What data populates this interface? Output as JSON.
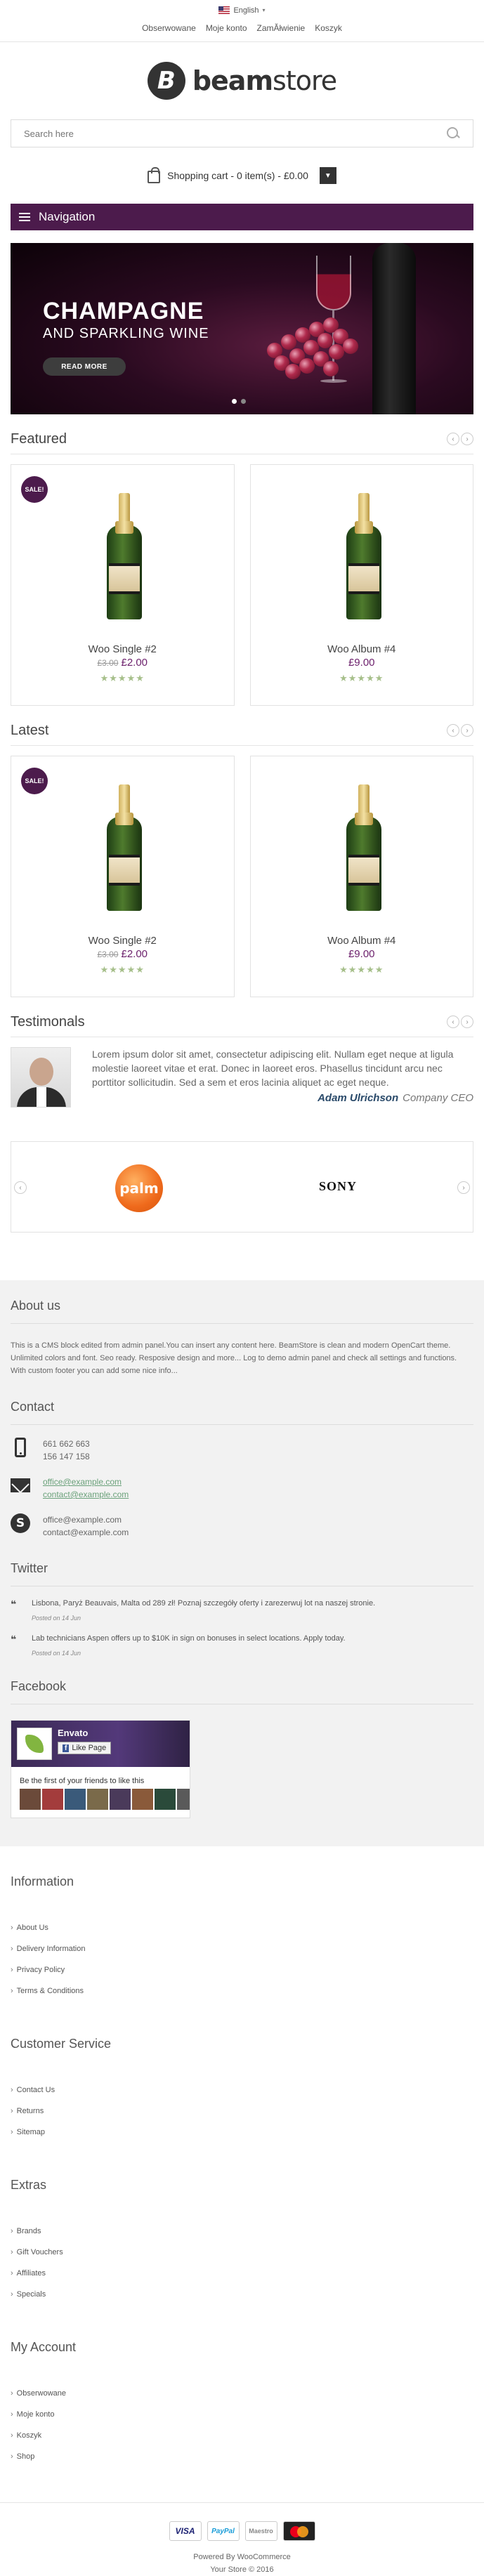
{
  "topbar": {
    "language": "English",
    "links": [
      "Obserwowane",
      "Moje konto",
      "ZamĂłwienie",
      "Koszyk"
    ]
  },
  "logo": {
    "mark": "B",
    "text_bold": "beam",
    "text_light": "store"
  },
  "search": {
    "placeholder": "Search here"
  },
  "cart": {
    "label": "Shopping cart - 0 item(s) - £0.00"
  },
  "nav": {
    "label": "Navigation"
  },
  "banner": {
    "title": "CHAMPAGNE",
    "subtitle": "AND SPARKLING WINE",
    "button": "READ MORE"
  },
  "featured": {
    "title": "Featured",
    "products": [
      {
        "sale": "SALE!",
        "name": "Woo Single #2",
        "old_price": "£3.00",
        "price": "£2.00",
        "stars": "★★★★★"
      },
      {
        "sale": "",
        "name": "Woo Album #4",
        "old_price": "",
        "price": "£9.00",
        "stars": "★★★★★"
      }
    ]
  },
  "latest": {
    "title": "Latest",
    "products": [
      {
        "sale": "SALE!",
        "name": "Woo Single #2",
        "old_price": "£3.00",
        "price": "£2.00",
        "stars": "★★★★★"
      },
      {
        "sale": "",
        "name": "Woo Album #4",
        "old_price": "",
        "price": "£9.00",
        "stars": "★★★★★"
      }
    ]
  },
  "testimonials": {
    "title": "Testimonals",
    "text": "Lorem ipsum dolor sit amet, consectetur adipiscing elit. Nullam eget neque at ligula molestie laoreet vitae et erat. Donec in laoreet eros. Phasellus tincidunt arcu nec porttitor sollicitudin. Sed a sem et eros lacinia aliquet ac eget neque.",
    "name": "Adam Ulrichson",
    "role": "Company CEO"
  },
  "brands": {
    "palm": "palm",
    "sony": "SONY"
  },
  "about": {
    "title": "About us",
    "text": "This is a CMS block edited from admin panel.You can insert any content here. BeamStore is clean and modern OpenCart theme. Unlimited colors and font. Seo ready. Resposive design and more... Log to demo admin panel and check all settings and functions. With custom footer you can add some nice info..."
  },
  "contact": {
    "title": "Contact",
    "phones": [
      "661 662 663",
      "156 147 158"
    ],
    "emails": [
      "office@example.com",
      "contact@example.com"
    ],
    "skype": [
      "office@example.com",
      "contact@example.com"
    ]
  },
  "twitter": {
    "title": "Twitter",
    "tweets": [
      {
        "text": "Lisbona, Paryż Beauvais, Malta od 289 zł! Poznaj szczegóły oferty i zarezerwuj lot na naszej stronie.",
        "date": "Posted on 14 Jun"
      },
      {
        "text": "Lab technicians Aspen offers up to $10K in sign on bonuses in select locations. Apply today.",
        "date": "Posted on 14 Jun"
      }
    ]
  },
  "facebook": {
    "title": "Facebook",
    "page_name": "Envato",
    "like": "Like Page",
    "friends_text": "Be the first of your friends to like this"
  },
  "information": {
    "title": "Information",
    "items": [
      "About Us",
      "Delivery Information",
      "Privacy Policy",
      "Terms & Conditions"
    ]
  },
  "customer_service": {
    "title": "Customer Service",
    "items": [
      "Contact Us",
      "Returns",
      "Sitemap"
    ]
  },
  "extras": {
    "title": "Extras",
    "items": [
      "Brands",
      "Gift Vouchers",
      "Affiliates",
      "Specials"
    ]
  },
  "account": {
    "title": "My Account",
    "items": [
      "Obserwowane",
      "Moje konto",
      "Koszyk",
      "Shop"
    ]
  },
  "payment": {
    "visa": "VISA",
    "paypal": "PayPal",
    "maestro": "Maestro"
  },
  "footer": {
    "powered": "Powered By WooCommerce",
    "copyright": "Your Store © 2016"
  },
  "colors": {
    "accent": "#4c1b4c",
    "price": "#6b1f6b",
    "stars": "#a6bf8a"
  }
}
